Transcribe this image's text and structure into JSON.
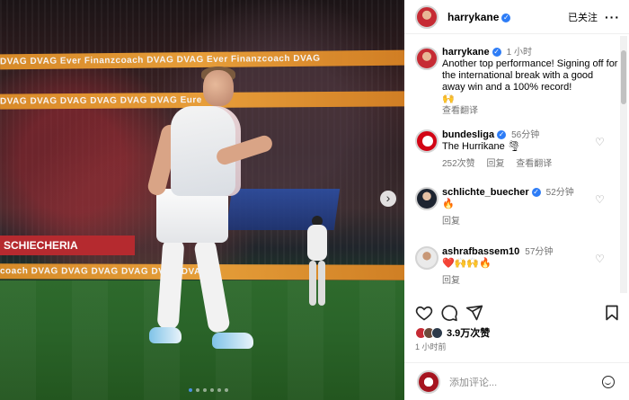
{
  "photo": {
    "board_text": "DVAG   DVAG   Ever Finanzcoach   DVAG   DVAG   Ever Finanzcoach   DVAG",
    "board_text_2": "DVAG   DVAG   DVAG   DVAG   DVAG   DVAG   Eure",
    "board_text_3": "coach   DVAG   DVAG   DVAG   DVAG   DVAG   DVAG",
    "banner_text": "SCHIECHERIA",
    "next_icon": "chevron-right-icon",
    "carousel_count": 6,
    "carousel_active": 1
  },
  "header": {
    "username": "harrykane",
    "verified": "✓",
    "follow_label": "已关注",
    "more_label": "···"
  },
  "caption": {
    "username": "harrykane",
    "time": "1 小时",
    "text": "Another top performance! Signing off for the international break with a good away win and a 100% record!",
    "emoji": "🙌",
    "translate": "查看翻译"
  },
  "comments": [
    {
      "username": "bundesliga",
      "time": "56分钟",
      "text": "The Hurrikane 🌪",
      "likes": "252次赞",
      "reply": "回复",
      "translate": "查看翻译"
    },
    {
      "username": "schlichte_buecher",
      "time": "52分钟",
      "text": "🔥",
      "reply": "回复"
    },
    {
      "username": "ashrafbassem10",
      "time": "57分钟",
      "text": "❤️🙌🙌🔥",
      "reply": "回复"
    }
  ],
  "stats": {
    "likes": "3.9万次赞",
    "ago": "1 小时前"
  },
  "composer": {
    "placeholder": "添加评论..."
  },
  "colors": {
    "verified": "#2d7cf6",
    "board": "#f0a43a"
  }
}
